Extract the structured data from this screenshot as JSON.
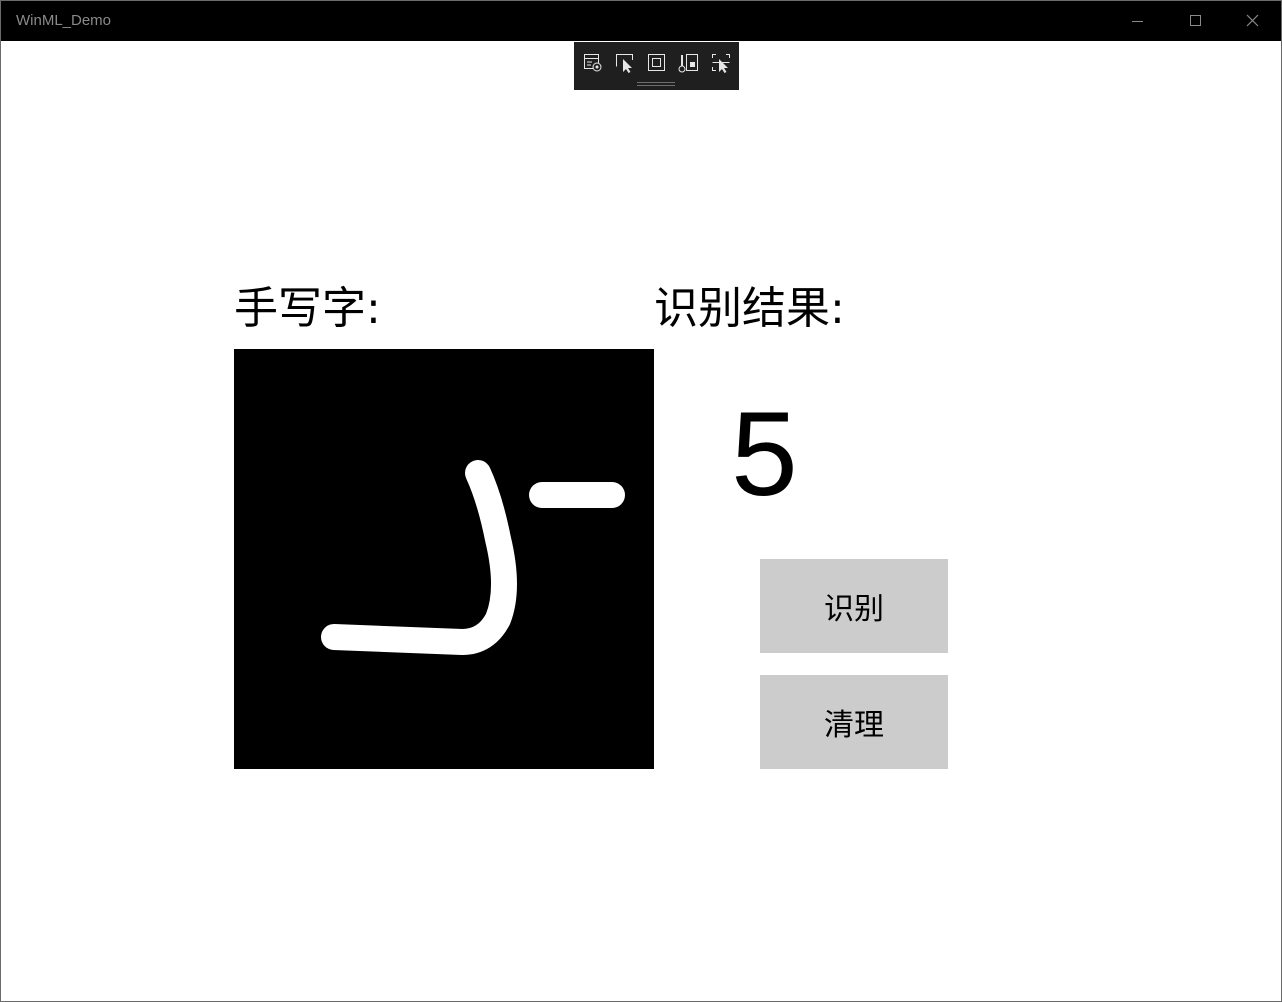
{
  "window": {
    "title": "WinML_Demo",
    "caption_buttons": [
      "minimize-icon",
      "maximize-icon",
      "close-icon"
    ]
  },
  "debug_toolbar": {
    "icons": [
      "live-visual-tree-icon",
      "select-element-icon",
      "display-layout-adorners-icon",
      "track-focus-icon",
      "element-picker-icon"
    ]
  },
  "main": {
    "handwriting_label": "手写字:",
    "result_label": "识别结果:",
    "result_value": "5",
    "recognize_button": "识别",
    "clear_button": "清理"
  },
  "colors": {
    "titlebar": "#000000",
    "canvas": "#000000",
    "ink": "#ffffff",
    "button": "#cccccc",
    "toolbar": "#1f1f1f"
  }
}
